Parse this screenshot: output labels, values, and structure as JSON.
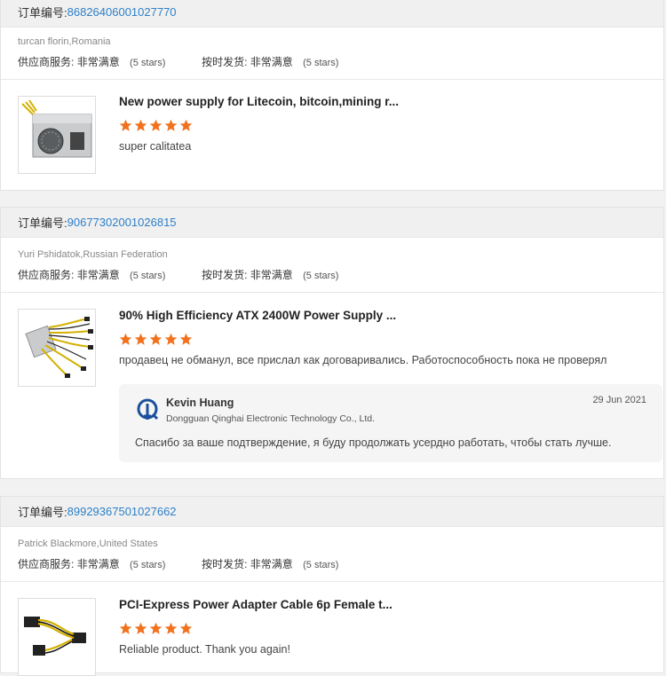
{
  "labels": {
    "order_prefix": "订单编号:",
    "supplier_service": "供应商服务:",
    "on_time_shipping": "按时发货:",
    "rating_text": "非常满意",
    "stars_text": "(5 stars)"
  },
  "orders": [
    {
      "order_no": "86826406001027770",
      "buyer": "turcan florin,Romania",
      "product_title": "New power supply for Litecoin, bitcoin,mining r...",
      "rating": 5,
      "review": "super calitatea",
      "thumb_icon": "psu-box-icon"
    },
    {
      "order_no": "90677302001026815",
      "buyer": "Yuri Pshidatok,Russian Federation",
      "product_title": "90% High Efficiency ATX 2400W Power Supply ...",
      "rating": 5,
      "review": "продавец не обманул, все прислал как договаривались. Работоспособность пока не проверял",
      "thumb_icon": "psu-cables-icon",
      "reply": {
        "name": "Kevin Huang",
        "company": "Dongguan Qinghai Electronic Technology Co., Ltd.",
        "date": "29 Jun 2021",
        "text": "Спасибо за ваше подтверждение, я буду продолжать усердно работать, чтобы стать лучше.",
        "logo_icon": "company-logo-icon"
      }
    },
    {
      "order_no": "89929367501027662",
      "buyer": "Patrick Blackmore,United States",
      "product_title": "PCI-Express Power Adapter Cable 6p Female t...",
      "rating": 5,
      "review": "Reliable product. Thank you again!",
      "thumb_icon": "cable-adapter-icon"
    }
  ],
  "colors": {
    "star": "#f2711c",
    "link": "#2e80c8"
  }
}
